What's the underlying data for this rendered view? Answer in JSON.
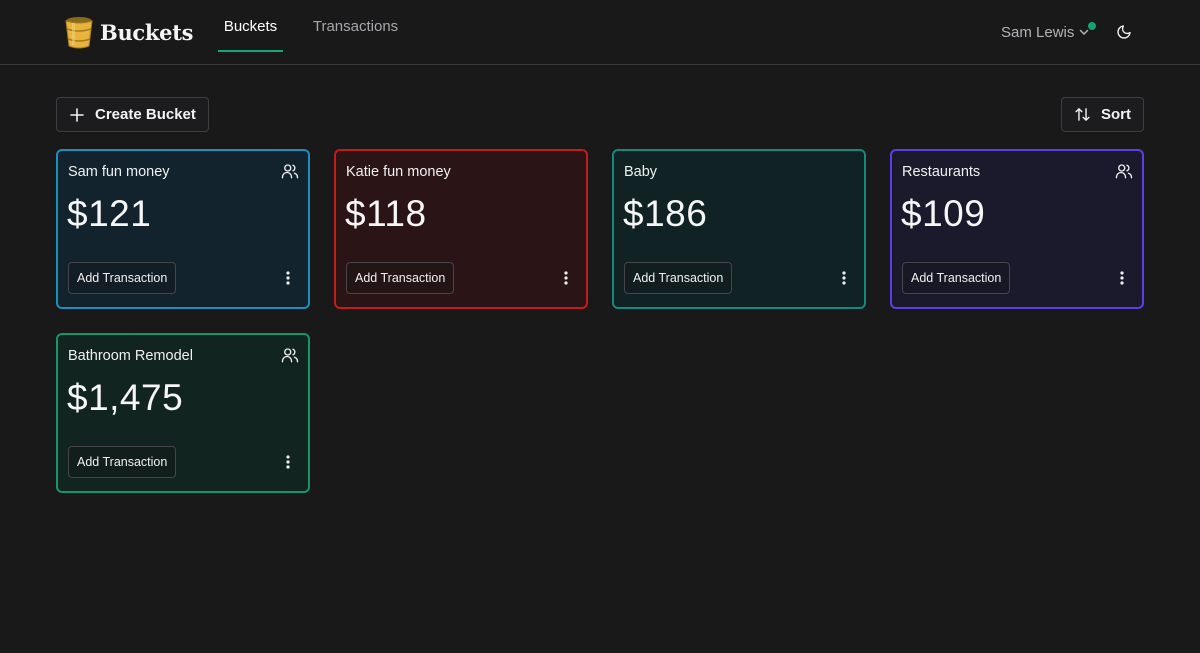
{
  "app": {
    "name": "Buckets"
  },
  "nav": {
    "tabs": [
      {
        "label": "Buckets",
        "active": true
      },
      {
        "label": "Transactions",
        "active": false
      }
    ]
  },
  "user": {
    "name": "Sam Lewis",
    "status_color": "#12a36f"
  },
  "toolbar": {
    "create_label": "Create Bucket",
    "sort_label": "Sort"
  },
  "icons": {
    "logo": "bucket-icon",
    "chevron": "chevron-down-icon",
    "theme": "moon-icon",
    "create": "plus-icon",
    "sort": "sort-arrows-icon",
    "shared": "users-icon",
    "more": "more-vertical-icon"
  },
  "buckets": [
    {
      "name": "Sam fun money",
      "amount": "$121",
      "shared": true,
      "color": "#1c8fc0",
      "action_label": "Add Transaction"
    },
    {
      "name": "Katie fun money",
      "amount": "$118",
      "shared": false,
      "color": "#c41b1b",
      "action_label": "Add Transaction"
    },
    {
      "name": "Baby",
      "amount": "$186",
      "shared": false,
      "color": "#15897e",
      "action_label": "Add Transaction"
    },
    {
      "name": "Restaurants",
      "amount": "$109",
      "shared": true,
      "color": "#5b3ee6",
      "action_label": "Add Transaction"
    },
    {
      "name": "Bathroom Remodel",
      "amount": "$1,475",
      "shared": true,
      "color": "#16946a",
      "action_label": "Add Transaction"
    }
  ],
  "accent_color": "#14a57a"
}
